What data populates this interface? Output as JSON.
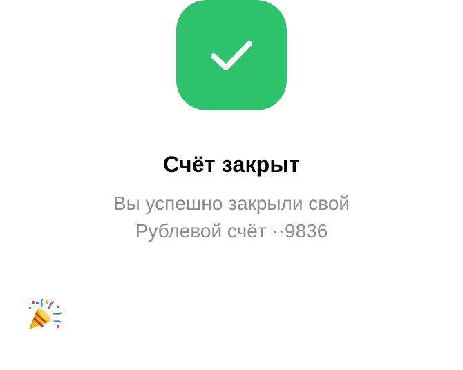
{
  "colors": {
    "success": "#2dc26b",
    "title": "#000000",
    "muted": "#8a8a8e"
  },
  "status": {
    "icon": "checkmark-icon"
  },
  "title": "Счёт закрыт",
  "message": {
    "line1": "Вы успешно закрыли свой",
    "line2": "Рублевой счёт ··9836"
  },
  "decoration": {
    "icon": "party-popper-icon"
  }
}
